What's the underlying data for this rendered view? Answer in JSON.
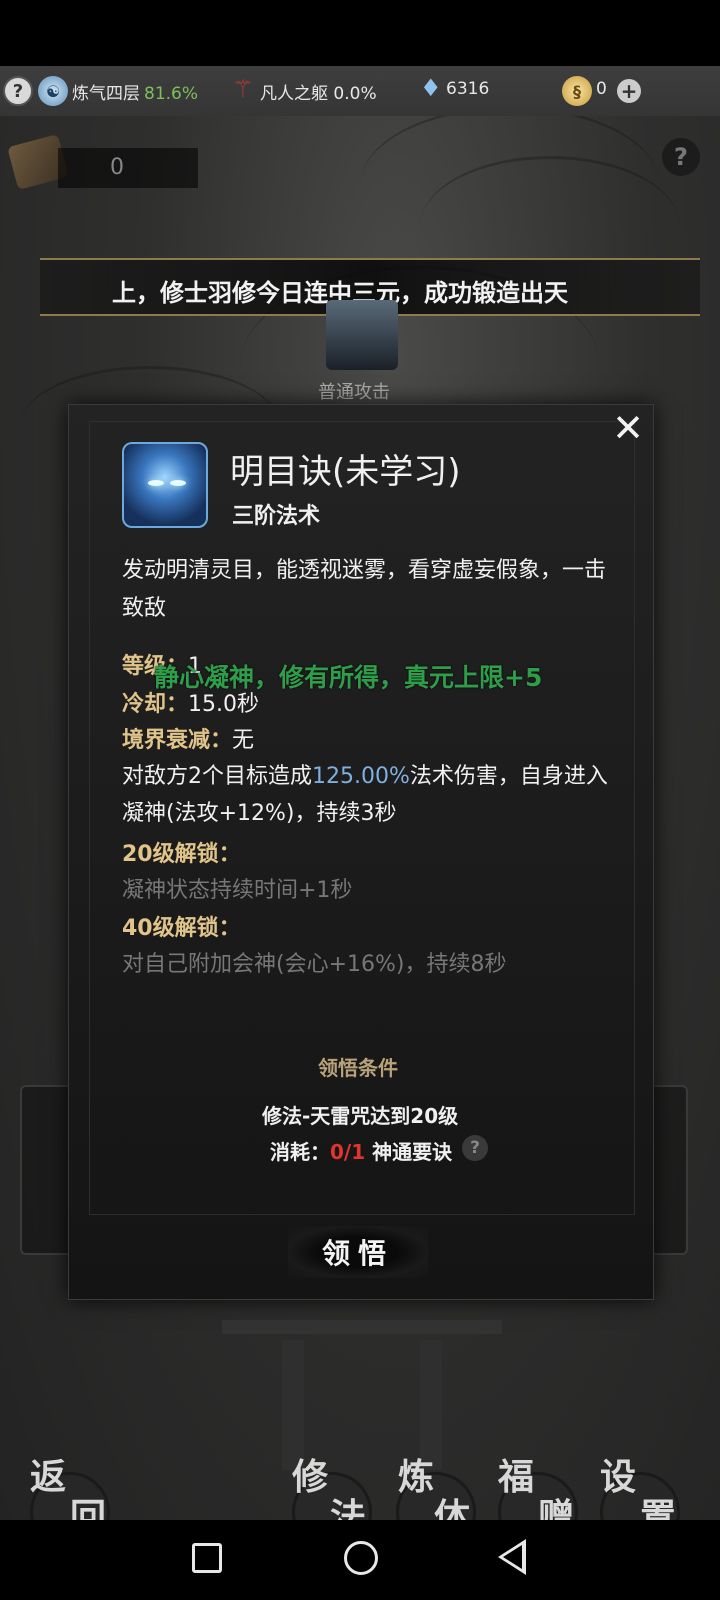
{
  "top_bar": {
    "help_icon": "?",
    "cultivation_label": "炼气四层",
    "cultivation_pct": "81.6%",
    "body_label": "凡人之躯 0.0%",
    "gem_value": "6316",
    "coin_value": "0",
    "add_icon": "+"
  },
  "score": {
    "value": "0"
  },
  "help_right": "?",
  "news": {
    "text": "上，修士羽修今日连中三元，成功锻造出天"
  },
  "attack": {
    "label": "普通攻击"
  },
  "skill": {
    "name": "明目诀(未学习)",
    "tier": "三阶法术",
    "description": "发动明清灵目，能透视迷雾，看穿虚妄假象，一击致敌",
    "level_key": "等级：",
    "level_value": "1",
    "cd_key": "冷却：",
    "cd_value": "15.0秒",
    "decay_key": "境界衰减：",
    "decay_value": "无",
    "effect_pre": "对敌方2个目标造成",
    "effect_pct": "125.00%",
    "effect_post": "法术伤害，自身进入凝神(法攻+12%)，持续3秒",
    "unlock20_title": "20级解锁：",
    "unlock20_desc": "凝神状态持续时间+1秒",
    "unlock40_title": "40级解锁：",
    "unlock40_desc": "对自己附加会神(会心+16%)，持续8秒"
  },
  "float_message": "静心凝神，修有所得，真元上限+5",
  "conditions": {
    "title": "领悟条件",
    "requirement": "修法-天雷咒达到20级",
    "cost_pre": "消耗：",
    "cost_count": "0/1",
    "cost_post": " 神通要诀",
    "help": "?"
  },
  "learn_button": "领悟",
  "bottom_nav": {
    "back": [
      "返",
      "回"
    ],
    "cultivate": [
      "修",
      "法"
    ],
    "refine": [
      "炼",
      "体"
    ],
    "gift": [
      "福",
      "赠"
    ],
    "settings": [
      "设",
      "置"
    ]
  },
  "icons": {
    "close": "close-icon",
    "skill": "glowing-eyes-icon",
    "gem": "crystal-icon",
    "coin": "spirit-coin-icon"
  },
  "colors": {
    "accent_gold": "#e0c48a",
    "green": "#2e9e4a",
    "blue_pct": "#7fb0e0",
    "red": "#e0352c"
  }
}
